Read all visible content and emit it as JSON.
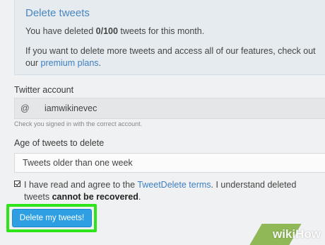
{
  "notice": {
    "title": "Delete tweets",
    "line1_prefix": "You have deleted ",
    "line1_count": "0/100",
    "line1_suffix": " tweets for this month.",
    "line2_text": "If you want to delete more tweets and access all of our features, check out our ",
    "line2_link": "premium plans",
    "line2_end": "."
  },
  "account": {
    "label": "Twitter account",
    "prefix": "@",
    "value": "iamwikinevec",
    "help": "Check you signed in with the correct account."
  },
  "age": {
    "label": "Age of tweets to delete",
    "selected": "Tweets older than one week"
  },
  "terms": {
    "checked": true,
    "text1": "I have read and agree to the ",
    "link": "TweetDelete terms",
    "text2": ". I understand deleted tweets ",
    "bold": "cannot be recovered",
    "text3": "."
  },
  "submit": {
    "label": "Delete my tweets!"
  },
  "watermark": {
    "text": "wikiHow"
  },
  "colors": {
    "accent": "#2d9fe2",
    "link": "#3d7fc2",
    "highlight": "#2ee51c"
  }
}
